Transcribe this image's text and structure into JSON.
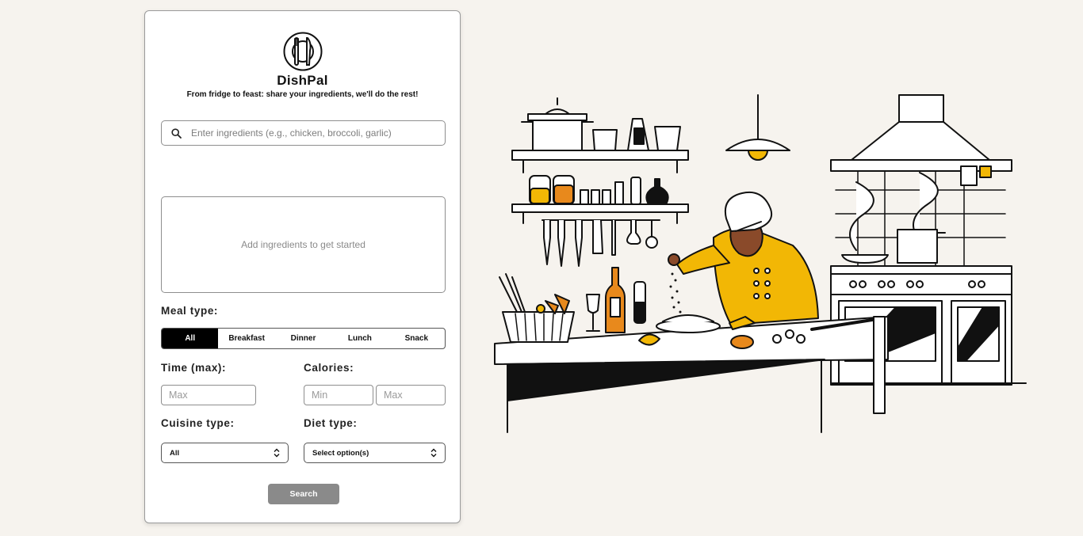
{
  "app": {
    "name": "DishPal",
    "tagline": "From fridge to feast: share your ingredients, we'll do the rest!",
    "logo_icon": "plate-fork-knife-icon"
  },
  "search": {
    "icon": "search-icon",
    "placeholder": "Enter ingredients (e.g., chicken, broccoli, garlic)",
    "value": ""
  },
  "ingredients": {
    "empty_message": "Add ingredients to get started"
  },
  "meal_type": {
    "label": "Meal type:",
    "options": [
      "All",
      "Breakfast",
      "Dinner",
      "Lunch",
      "Snack"
    ],
    "selected": "All"
  },
  "time": {
    "label": "Time (max):",
    "max_placeholder": "Max"
  },
  "calories": {
    "label": "Calories:",
    "min_placeholder": "Min",
    "max_placeholder": "Max"
  },
  "cuisine": {
    "label": "Cuisine type:",
    "selected": "All"
  },
  "diet": {
    "label": "Diet type:",
    "selected": "Select option(s)"
  },
  "search_button": {
    "label": "Search"
  },
  "colors": {
    "background": "#f6f3ee",
    "accent_yellow": "#f2b705",
    "accent_orange": "#e8891c",
    "ink": "#111111",
    "button_gray": "#8a8a8a"
  }
}
